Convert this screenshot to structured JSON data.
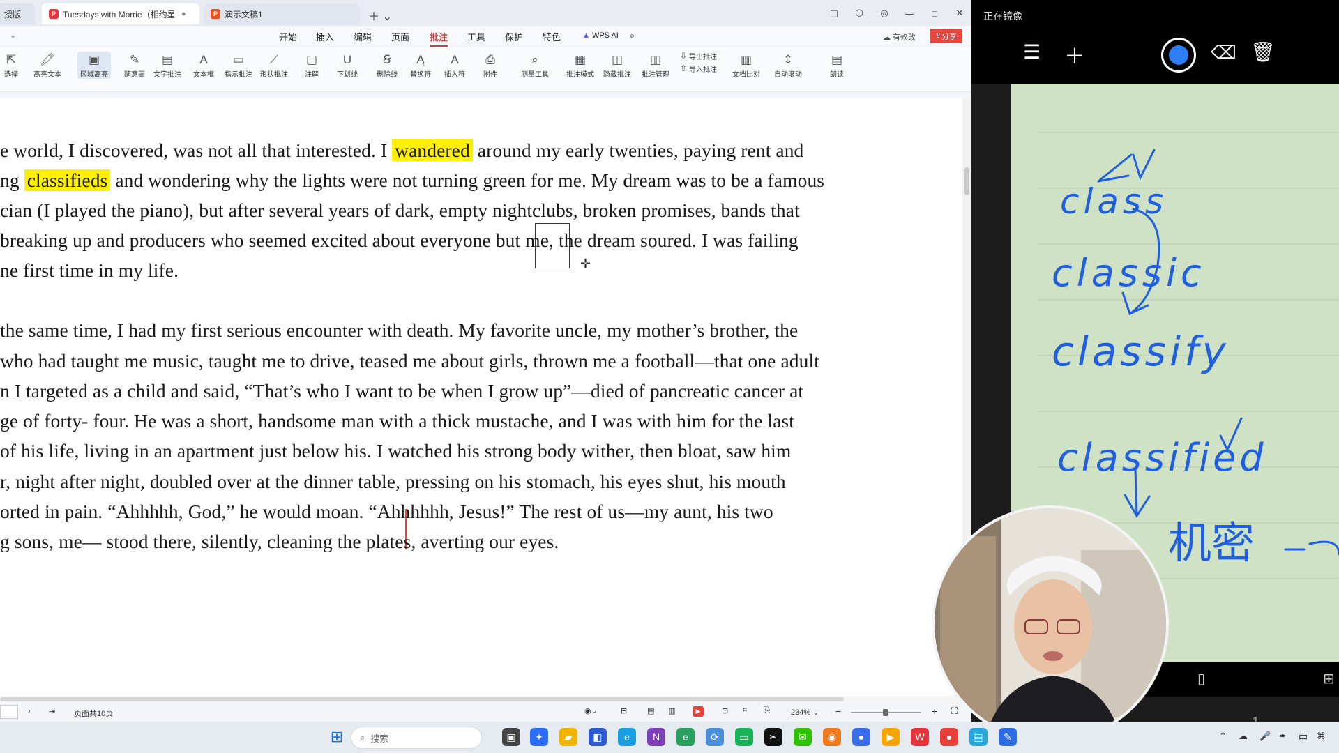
{
  "tabs": [
    {
      "label": "授版",
      "partial": true
    },
    {
      "label": "Tuesdays with Morrie（相约星",
      "active": true
    },
    {
      "label": "演示文稿1"
    }
  ],
  "window_controls": [
    "▢",
    "⬡",
    "◎",
    "—",
    "□",
    "✕"
  ],
  "menu": {
    "items": [
      "开始",
      "插入",
      "编辑",
      "页面",
      "批注",
      "工具",
      "保护",
      "特色"
    ],
    "active": "批注",
    "wps_ai": "WPS AI",
    "has_edit": "有修改",
    "share": "分享"
  },
  "toolbar": {
    "tools": [
      {
        "label": "选择",
        "icon": "select-icon"
      },
      {
        "label": "高亮文本",
        "icon": "highlight-text-icon"
      },
      {
        "label": "区域高亮",
        "icon": "area-highlight-icon",
        "selected": true
      },
      {
        "label": "随意画",
        "icon": "freehand-icon"
      },
      {
        "label": "文字批注",
        "icon": "text-comment-icon"
      },
      {
        "label": "文本框",
        "icon": "textbox-icon"
      },
      {
        "label": "指示批注",
        "icon": "callout-icon"
      },
      {
        "label": "形状批注",
        "icon": "shape-comment-icon"
      },
      {
        "label": "注解",
        "icon": "note-icon"
      },
      {
        "label": "下划线",
        "icon": "underline-icon"
      },
      {
        "label": "删除线",
        "icon": "strikethrough-icon"
      },
      {
        "label": "替换符",
        "icon": "replace-icon"
      },
      {
        "label": "插入符",
        "icon": "insert-icon"
      },
      {
        "label": "附件",
        "icon": "attachment-icon"
      },
      {
        "label": "测量工具",
        "icon": "measure-icon"
      },
      {
        "label": "批注模式",
        "icon": "comment-mode-icon"
      },
      {
        "label": "隐藏批注",
        "icon": "hide-comment-icon"
      },
      {
        "label": "批注管理",
        "icon": "comment-manage-icon"
      },
      {
        "label": "导出批注",
        "icon": "export-comment-icon"
      },
      {
        "label": "导入批注",
        "icon": "import-comment-icon"
      },
      {
        "label": "文档比对",
        "icon": "compare-icon"
      },
      {
        "label": "自动滚动",
        "icon": "autoscroll-icon"
      },
      {
        "label": "朗读",
        "icon": "read-aloud-icon"
      }
    ]
  },
  "document": {
    "lines": [
      {
        "parts": [
          {
            "t": "e world, I discovered, was not all that interested. I "
          },
          {
            "t": "wandered",
            "hl": true
          },
          {
            "t": " around my early twenties, paying rent and"
          }
        ]
      },
      {
        "parts": [
          {
            "t": "ng "
          },
          {
            "t": "classifieds",
            "hl": true
          },
          {
            "t": " and wondering why the lights were not turning green for me. My dream was to be a famous"
          }
        ]
      },
      {
        "parts": [
          {
            "t": "cian (I played the piano), but after several years of dark, empty nightclubs, broken promises, bands that"
          }
        ]
      },
      {
        "parts": [
          {
            "t": "breaking up and producers who seemed excited about everyone but me, the dream soured. I was failing"
          }
        ]
      },
      {
        "parts": [
          {
            "t": "ne first time in my life."
          }
        ]
      },
      {
        "parts": [
          {
            "t": " the same time, I had my first serious encounter with death. My favorite uncle, my mother’s brother, the"
          }
        ]
      },
      {
        "parts": [
          {
            "t": "who had taught me music, taught me to drive, teased me about girls, thrown me a football—that one adult"
          }
        ]
      },
      {
        "parts": [
          {
            "t": "n I targeted as a child and said, “That’s who I want to be when I grow up”—died of pancreatic cancer at"
          }
        ]
      },
      {
        "parts": [
          {
            "t": "ge of forty- four. He was a short, handsome man with a thick mustache, and I was with him for the last"
          }
        ]
      },
      {
        "parts": [
          {
            "t": "of his life, living in an apartment just below his. I watched his strong body wither, then bloat, saw him"
          }
        ]
      },
      {
        "parts": [
          {
            "t": "r, night after night, doubled over at the dinner table, pressing on his stomach, his eyes shut, his mouth"
          }
        ]
      },
      {
        "parts": [
          {
            "t": "orted in pain. “Ahhhhh, God,” he would moan. “Ahhhhhh, Jesus!” The rest of us—my aunt, his two"
          }
        ]
      },
      {
        "parts": [
          {
            "t": "g sons, me— stood there, silently, cleaning the plates, averting our eyes."
          }
        ]
      }
    ]
  },
  "status": {
    "page_info": "页面共10页",
    "zoom": "234%",
    "zoom_level": 0.5
  },
  "notes_app": {
    "title": "正在镜像",
    "page_number": "1",
    "pen_color": "#2f7df6",
    "handwriting": [
      "class",
      "classic",
      "classify",
      "classified",
      "机密"
    ]
  },
  "taskbar": {
    "search_placeholder": "搜索"
  }
}
